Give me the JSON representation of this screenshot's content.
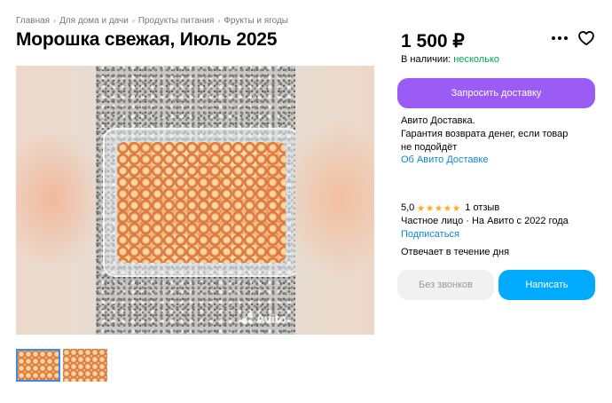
{
  "breadcrumb": [
    "Главная",
    "Для дома и дачи",
    "Продукты питания",
    "Фрукты и ягоды"
  ],
  "title": "Морошка свежая, Июль 2025",
  "gallery": {
    "watermark": "Avito",
    "thumbnails": 2,
    "selected_thumbnail": 1
  },
  "price": "1 500 ₽",
  "availability": {
    "label": "В наличии:",
    "value": "несколько"
  },
  "delivery_button": "Запросить доставку",
  "delivery_info": {
    "line1": "Авито Доставка.",
    "line2": "Гарантия возврата денег, если товар",
    "line3": "не подойдёт",
    "link": "Об Авито Доставке"
  },
  "seller": {
    "rating": "5,0",
    "stars": 5,
    "reviews": "1 отзыв",
    "type": "Частное лицо · На Авито с 2022 года",
    "subscribe": "Подписаться",
    "response": "Отвечает в течение дня"
  },
  "actions": {
    "no_calls": "Без звонков",
    "write": "Написать"
  },
  "icons": {
    "more": "more-dots-icon",
    "favorite": "heart-icon",
    "star": "star-icon"
  },
  "colors": {
    "accent_purple": "#9b5cf6",
    "accent_blue": "#00aaff",
    "link": "#0a88d4",
    "available": "#02a653",
    "star": "#ffb021"
  }
}
